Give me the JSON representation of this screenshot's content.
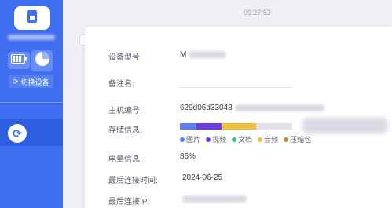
{
  "sidebar": {
    "switch_device_label": "切换设备",
    "icons": {
      "device": "phone-icon",
      "battery": "battery-icon",
      "storage": "pie-icon",
      "switch": "switch-icon",
      "nav_active": "sync-icon"
    },
    "colors": {
      "background": "#3f6ef1",
      "active": "#2f5de0"
    }
  },
  "chat": {
    "timestamp": "09:27:52"
  },
  "device_info": {
    "model_label": "设备型号",
    "model_value": "M",
    "note_label": "备注名:",
    "host_id_label": "主机编号:",
    "host_id_value": "629d06d33048",
    "storage_label": "存储信息:",
    "storage_segments": [
      {
        "name": "图片",
        "color": "#5b7ff0",
        "fraction": 0.15
      },
      {
        "name": "视频",
        "color": "#6a3de8",
        "fraction": 0.22
      },
      {
        "name": "文档",
        "color": "#2ec08f",
        "fraction": 0.0
      },
      {
        "name": "音频",
        "color": "#f2c037",
        "fraction": 0.31
      },
      {
        "name": "压缩包",
        "color": "#c98a2a",
        "fraction": 0.0
      }
    ],
    "battery_label": "电量信息:",
    "battery_value": "86%",
    "last_connect_time_label": "最后连接时间:",
    "last_connect_time_value": "2024-06-25",
    "last_connect_ip_label": "最后连接IP:"
  }
}
